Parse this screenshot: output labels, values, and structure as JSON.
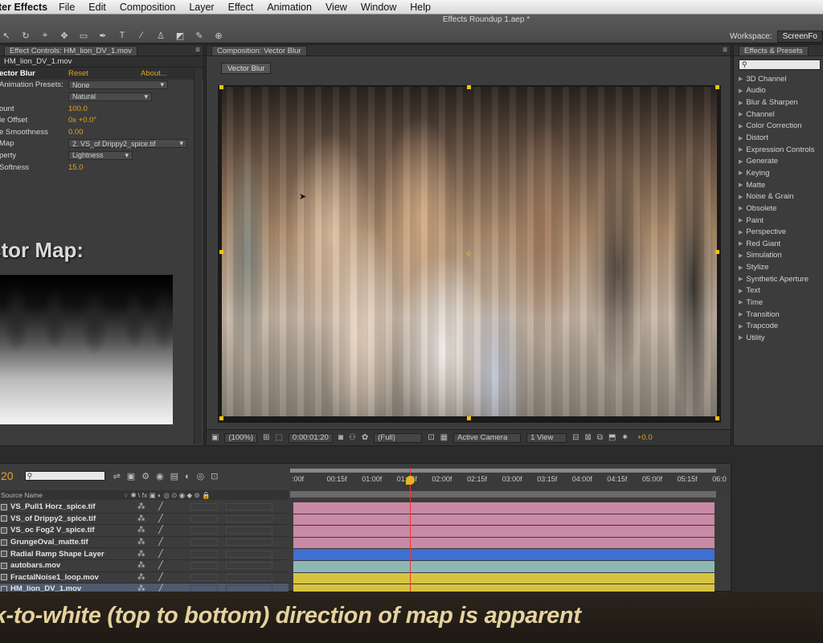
{
  "menubar": {
    "app_name": "ter Effects",
    "items": [
      "File",
      "Edit",
      "Composition",
      "Layer",
      "Effect",
      "Animation",
      "View",
      "Window",
      "Help"
    ]
  },
  "titlebar": {
    "document_title": "Effects Roundup 1.aep *",
    "workspace_label": "Workspace:",
    "workspace_value": "ScreenFo"
  },
  "effect_controls": {
    "tab": "Effect Controls: HM_lion_DV_1.mov",
    "subheader": "HM_lion_DV_1.mov",
    "effect_name": "ector Blur",
    "reset": "Reset",
    "about": "About...",
    "rows": [
      {
        "label": "Animation Presets:",
        "value": "None",
        "kind": "dropdown"
      },
      {
        "label": "",
        "value": "Natural",
        "kind": "dropdown"
      },
      {
        "label": "ount",
        "value": "100.0",
        "kind": "value"
      },
      {
        "label": "le Offset",
        "value": "0x +0.0°",
        "kind": "value"
      },
      {
        "label": "e Smoothness",
        "value": "0.00",
        "kind": "value"
      },
      {
        "label": "Map",
        "value": "2. VS_of Drippy2_spice.tif",
        "kind": "dropdown"
      },
      {
        "label": "perty",
        "value": "Lightness",
        "kind": "dropdown"
      },
      {
        "label": "Softness",
        "value": "15.0",
        "kind": "value"
      }
    ],
    "overlay_title": "ctor Map:"
  },
  "composition": {
    "tab": "Composition: Vector Blur",
    "chip": "Vector Blur",
    "zoom": "(100%)",
    "timecode": "0:00:01:20",
    "resolution": "(Full)",
    "camera": "Active Camera",
    "views": "1 View",
    "exposure": "+0.0"
  },
  "effects_presets": {
    "tab": "Effects & Presets",
    "search_placeholder": "",
    "categories": [
      "3D Channel",
      "Audio",
      "Blur & Sharpen",
      "Channel",
      "Color Correction",
      "Distort",
      "Expression Controls",
      "Generate",
      "Keying",
      "Matte",
      "Noise & Grain",
      "Obsolete",
      "Paint",
      "Perspective",
      "Red Giant",
      "Simulation",
      "Stylize",
      "Synthetic Aperture",
      "Text",
      "Time",
      "Transition",
      "Trapcode",
      "Utility"
    ]
  },
  "timeline": {
    "timecode": "20",
    "source_name_header": "Source Name",
    "ruler_ticks": [
      ":00f",
      "00:15f",
      "01:00f",
      "01:15f",
      "02:00f",
      "02:15f",
      "03:00f",
      "03:15f",
      "04:00f",
      "04:15f",
      "05:00f",
      "05:15f",
      "06:0"
    ],
    "layers": [
      {
        "name": "VS_Pull1 Horz_spice.tif",
        "color": "#c98aa6"
      },
      {
        "name": "VS_of Drippy2_spice.tif",
        "color": "#c98aa6"
      },
      {
        "name": "VS_oc Fog2 V_spice.tif",
        "color": "#c98aa6"
      },
      {
        "name": "GrungeOval_matte.tif",
        "color": "#c98aa6"
      },
      {
        "name": "Radial Ramp Shape Layer",
        "color": "#3f6fd0"
      },
      {
        "name": "autobars.mov",
        "color": "#8fb8b4"
      },
      {
        "name": "FractalNoise1_loop.mov",
        "color": "#d6c440"
      },
      {
        "name": "HM_lion_DV_1.mov",
        "color": "#d6c440"
      }
    ]
  },
  "caption": {
    "text": "ack-to-white (top to bottom) direction of map is apparent"
  }
}
